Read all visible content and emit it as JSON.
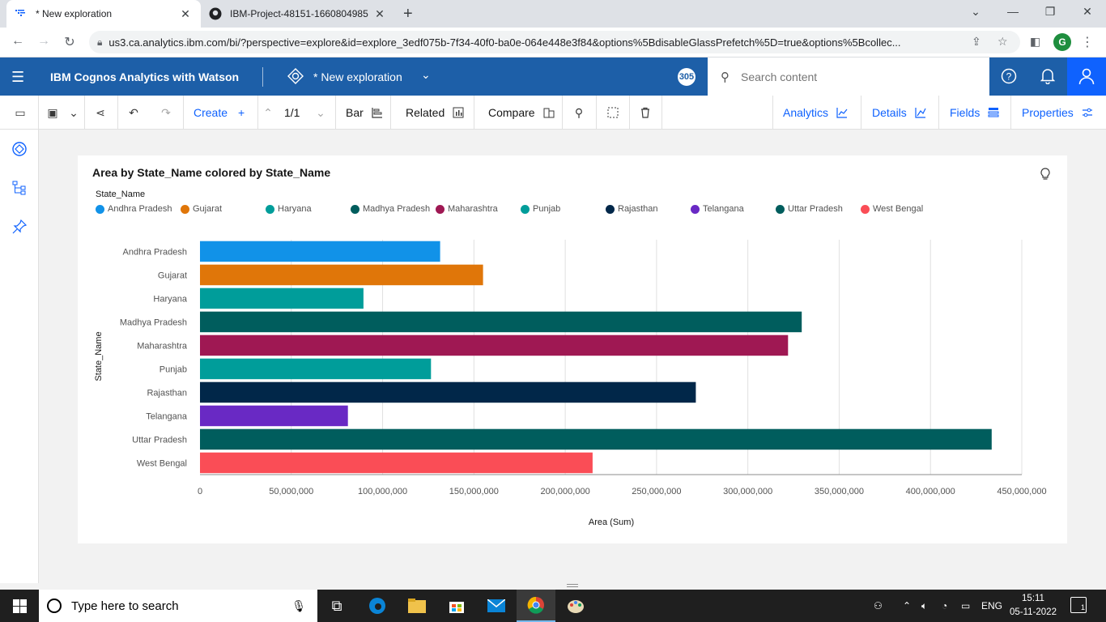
{
  "browser": {
    "tabs": [
      {
        "title": "* New exploration",
        "active": true
      },
      {
        "title": "IBM-Project-48151-1660804985",
        "active": false
      }
    ],
    "url": "us3.ca.analytics.ibm.com/bi/?perspective=explore&id=explore_3edf075b-7f34-40f0-ba0e-064e448e3f84&options%5BdisableGlassPrefetch%5D=true&options%5Bcollec...",
    "profile_initial": "G"
  },
  "app": {
    "product": "IBM Cognos Analytics with Watson",
    "exploration_title": "* New exploration",
    "badge": "305",
    "search_placeholder": "Search content",
    "colors": {
      "header": "#1d5fa8",
      "accent": "#0f62fe"
    }
  },
  "toolbar": {
    "create": "Create",
    "page": "1/1",
    "chart_type": "Bar",
    "related": "Related",
    "compare": "Compare",
    "analytics": "Analytics",
    "details": "Details",
    "fields": "Fields",
    "properties": "Properties"
  },
  "chart_data": {
    "type": "bar",
    "orientation": "horizontal",
    "title": "Area by State_Name colored by State_Name",
    "legend_title": "State_Name",
    "legend_position": "top",
    "xlabel": "Area (Sum)",
    "ylabel": "State_Name",
    "xlim": [
      0,
      450000000
    ],
    "x_ticks": [
      "0",
      "50,000,000",
      "100,000,000",
      "150,000,000",
      "200,000,000",
      "250,000,000",
      "300,000,000",
      "350,000,000",
      "400,000,000",
      "450,000,000"
    ],
    "x_tick_values": [
      0,
      50000000,
      100000000,
      150000000,
      200000000,
      250000000,
      300000000,
      350000000,
      400000000,
      450000000
    ],
    "grid": true,
    "categories": [
      "Andhra Pradesh",
      "Gujarat",
      "Haryana",
      "Madhya Pradesh",
      "Maharashtra",
      "Punjab",
      "Rajasthan",
      "Telangana",
      "Uttar Pradesh",
      "West Bengal"
    ],
    "values": [
      131500000,
      155000000,
      89500000,
      329500000,
      322000000,
      126500000,
      271500000,
      81000000,
      433500000,
      215000000
    ],
    "colors": [
      "#1192e8",
      "#e07609",
      "#009d9a",
      "#005d5d",
      "#9f1853",
      "#009d9a",
      "#012749",
      "#6929c4",
      "#005d5d",
      "#fa4d56"
    ]
  },
  "taskbar": {
    "search_placeholder": "Type here to search",
    "language": "ENG",
    "time": "15:11",
    "date": "05-11-2022",
    "notifications": "1"
  }
}
